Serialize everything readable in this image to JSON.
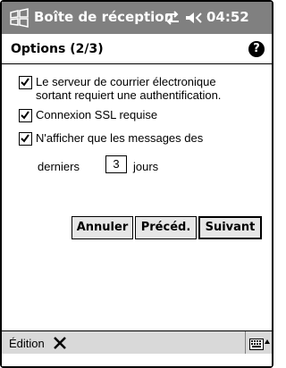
{
  "title_bar": {
    "app_title": "Boîte de réception",
    "time": "04:52",
    "icons": [
      "windows-start-icon",
      "connectivity-icon",
      "volume-icon"
    ]
  },
  "header": {
    "page_title": "Options (2/3)",
    "help_icon": "?"
  },
  "options": [
    {
      "label_line1": "Le serveur de courrier électronique",
      "label_line2": "sortant requiert une authentification.",
      "checked": true
    },
    {
      "label_line1": "Connexion SSL requise",
      "checked": true
    },
    {
      "label_line1": "N'afficher que les messages des",
      "checked": true
    }
  ],
  "days": {
    "prefix": "derniers",
    "value": "3",
    "suffix": "jours"
  },
  "buttons": {
    "cancel": "Annuler",
    "previous": "Précéd.",
    "next": "Suivant"
  },
  "menu_bar": {
    "edit_label": "Édition",
    "icons": [
      "delete-icon",
      "keyboard-icon"
    ]
  }
}
